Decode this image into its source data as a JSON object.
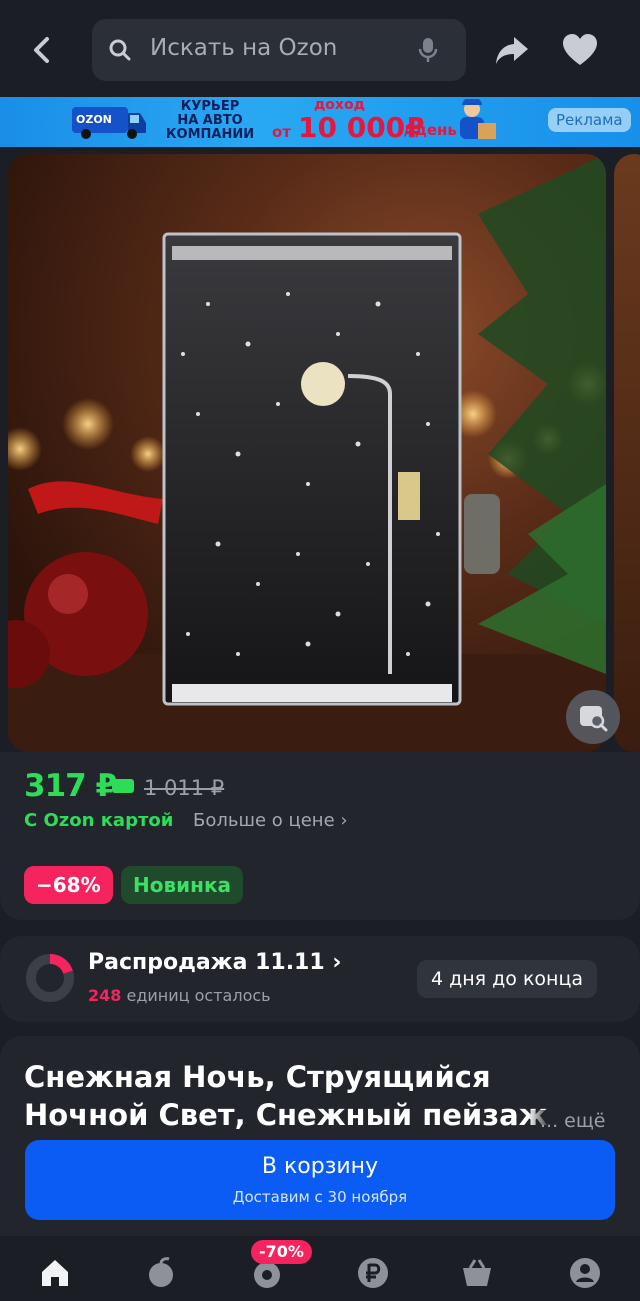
{
  "header": {
    "search_placeholder": "Искать на Ozon"
  },
  "banner": {
    "brand": "OZON",
    "line1": "КУРЬЕР",
    "line2": "НА АВТО",
    "line3": "КОМПАНИИ",
    "income_label": "доход",
    "from": "от",
    "amount": "10 000₽",
    "per_day": "/ день",
    "ad_tag": "Реклама"
  },
  "price": {
    "current": "317 ₽",
    "old": "1 011 ₽",
    "card_label": "С Ozon картой",
    "more_label": "Больше о цене ›",
    "discount_badge": "−68%",
    "new_badge": "Новинка"
  },
  "sale": {
    "title": "Распродажа 11.11 ›",
    "remaining_count": "248",
    "remaining_label": " единиц осталось",
    "days_left": "4 дня до конца",
    "progress": 0.2
  },
  "product": {
    "title": "Снежная Ночь, Струящийся Ночной Свет, Снежный пейзаж",
    "more_label": "... ещё"
  },
  "cart": {
    "label": "В корзину",
    "delivery": "Доставим с 30 ноября"
  },
  "nav": {
    "promo_badge": "-70%",
    "items": [
      "home-icon",
      "fresh-icon",
      "promo-icon",
      "finance-icon",
      "cart-icon",
      "profile-icon"
    ]
  },
  "colors": {
    "background": "#1b1e24",
    "card": "#22252c",
    "price_green": "#2ddc57",
    "accent_pink": "#f5245f",
    "button_blue": "#0a5cf5"
  }
}
